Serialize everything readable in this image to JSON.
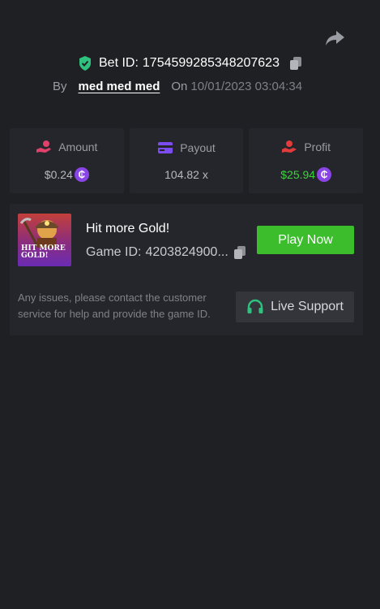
{
  "header": {
    "bet_id_label": "Bet ID:",
    "bet_id": "1754599285348207623",
    "by_label": "By",
    "username": "med med med",
    "on_label": "On",
    "datetime": "10/01/2023 03:04:34"
  },
  "stats": {
    "amount": {
      "label": "Amount",
      "value": "$0.24",
      "icon": "hand-coins-icon"
    },
    "payout": {
      "label": "Payout",
      "value": "104.82 x",
      "icon": "card-icon"
    },
    "profit": {
      "label": "Profit",
      "value": "$25.94",
      "icon": "hand-money-icon"
    },
    "coin_symbol": "₵"
  },
  "game": {
    "thumb_text": "HIT MORE GOLD!",
    "title": "Hit more Gold!",
    "game_id_label": "Game ID:",
    "game_id": "4203824900...",
    "play_label": "Play Now"
  },
  "support": {
    "help_text": "Any issues, please contact the customer service for help and provide the game ID.",
    "button_label": "Live Support"
  },
  "colors": {
    "background": "#1f2024",
    "card": "#25262b",
    "green": "#3bbd2c",
    "profit_green": "#3ad33a",
    "coin_purple": "#8a45e6",
    "amount_icon": "#e0416b",
    "payout_icon": "#7b4cf0",
    "profit_icon": "#e03c3c",
    "support_icon": "#2ec27e"
  }
}
